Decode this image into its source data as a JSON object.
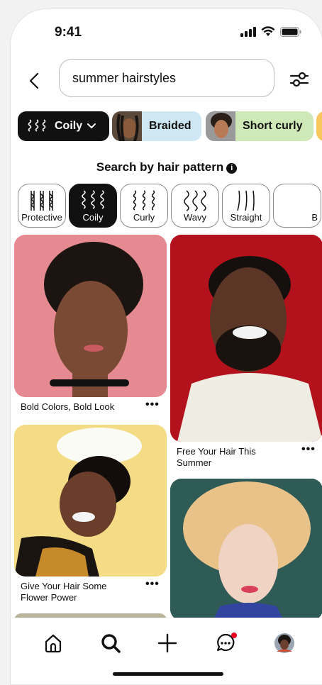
{
  "status_bar": {
    "time": "9:41"
  },
  "search": {
    "query": "summer hairstyles"
  },
  "chips": [
    {
      "label": "Coily",
      "selected": true
    },
    {
      "label": "Braided",
      "color": "#cfe7f2"
    },
    {
      "label": "Short curly",
      "color": "#cfe8b8"
    }
  ],
  "pattern_section": {
    "title": "Search by hair pattern",
    "info_icon": "info-icon",
    "items": [
      {
        "label": "Protective",
        "selected": false
      },
      {
        "label": "Coily",
        "selected": true
      },
      {
        "label": "Curly",
        "selected": false
      },
      {
        "label": "Wavy",
        "selected": false
      },
      {
        "label": "Straight",
        "selected": false
      },
      {
        "label": "B",
        "selected": false
      }
    ]
  },
  "pins": [
    {
      "title": "Bold Colors, Bold Look",
      "bg": "#e58a90"
    },
    {
      "title": "Free Your Hair This Summer",
      "bg": "#b3121d"
    },
    {
      "title": "Give Your Hair Some Flower Power",
      "bg": "#f3dc85"
    },
    {
      "title": "",
      "bg": "#2f5b57"
    }
  ],
  "more_label": "•••",
  "nav": [
    "home-icon",
    "search-icon",
    "plus-icon",
    "messages-icon",
    "profile-avatar"
  ],
  "colors": {
    "selected": "#111111",
    "notification": "#e60023"
  }
}
